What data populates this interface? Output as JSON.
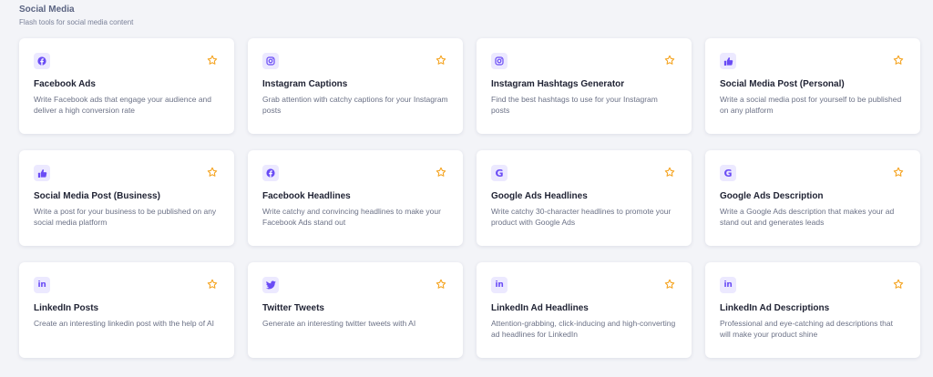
{
  "section": {
    "title": "Social Media",
    "subtitle": "Flash tools for social media content"
  },
  "colors": {
    "accent": "#6a4cf5",
    "icon_bg": "#ece9ff",
    "star": "#f5a524"
  },
  "cards": [
    {
      "icon": "facebook-icon",
      "title": "Facebook Ads",
      "description": "Write Facebook ads that engage your audience and deliver a high conversion rate"
    },
    {
      "icon": "instagram-icon",
      "title": "Instagram Captions",
      "description": "Grab attention with catchy captions for your Instagram posts"
    },
    {
      "icon": "instagram-icon",
      "title": "Instagram Hashtags Generator",
      "description": "Find the best hashtags to use for your Instagram posts"
    },
    {
      "icon": "thumbs-up-icon",
      "title": "Social Media Post (Personal)",
      "description": "Write a social media post for yourself to be published on any platform"
    },
    {
      "icon": "thumbs-up-icon",
      "title": "Social Media Post (Business)",
      "description": "Write a post for your business to be published on any social media platform"
    },
    {
      "icon": "facebook-icon",
      "title": "Facebook Headlines",
      "description": "Write catchy and convincing headlines to make your Facebook Ads stand out"
    },
    {
      "icon": "google-icon",
      "title": "Google Ads Headlines",
      "description": "Write catchy 30-character headlines to promote your product with Google Ads"
    },
    {
      "icon": "google-icon",
      "title": "Google Ads Description",
      "description": "Write a Google Ads description that makes your ad stand out and generates leads"
    },
    {
      "icon": "linkedin-icon",
      "title": "LinkedIn Posts",
      "description": "Create an interesting linkedin post with the help of AI"
    },
    {
      "icon": "twitter-icon",
      "title": "Twitter Tweets",
      "description": "Generate an interesting twitter tweets with AI"
    },
    {
      "icon": "linkedin-icon",
      "title": "LinkedIn Ad Headlines",
      "description": "Attention-grabbing, click-inducing and high-converting ad headlines for LinkedIn"
    },
    {
      "icon": "linkedin-icon",
      "title": "LinkedIn Ad Descriptions",
      "description": "Professional and eye-catching ad descriptions that will make your product shine"
    }
  ]
}
